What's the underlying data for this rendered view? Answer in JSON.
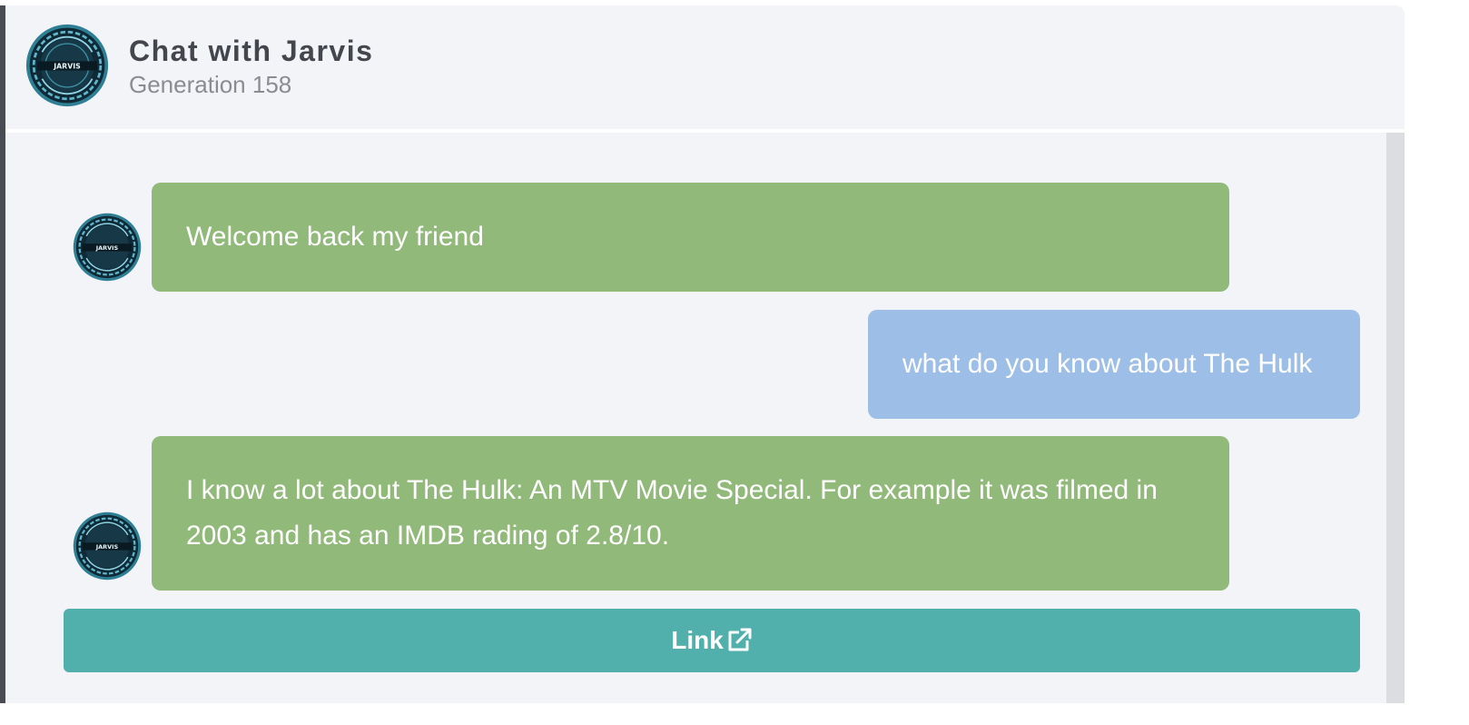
{
  "header": {
    "title": "Chat with Jarvis",
    "subtitle": "Generation 158",
    "avatar_icon": "jarvis-logo-icon",
    "avatar_text": "JARVIS"
  },
  "messages": [
    {
      "sender": "bot",
      "text": "Welcome back my friend"
    },
    {
      "sender": "user",
      "text": "what do you know about The Hulk"
    },
    {
      "sender": "bot",
      "text": "I know a lot about The Hulk: An MTV Movie Special. For example it was filmed in 2003 and has an IMDB rading of 2.8/10."
    }
  ],
  "link_button": {
    "label": "Link",
    "icon": "external-link-icon"
  },
  "colors": {
    "bot_bubble": "#91b979",
    "user_bubble": "#9dbfe7",
    "link_button": "#51b0ac",
    "background": "#f2f4f8"
  }
}
